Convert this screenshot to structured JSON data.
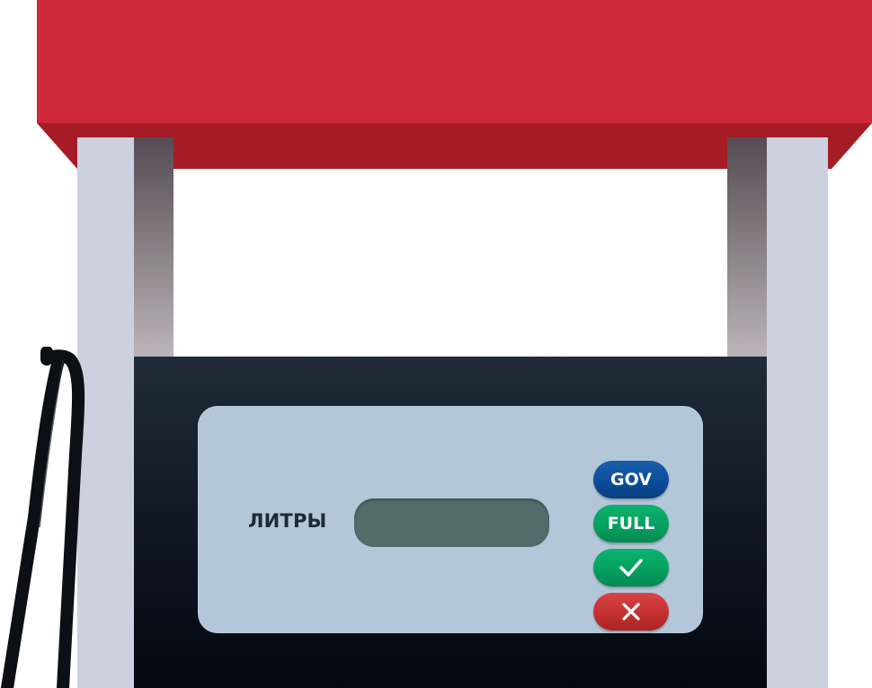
{
  "display": {
    "label": "ЛИТРЫ",
    "value": ""
  },
  "buttons": {
    "gov_label": "GOV",
    "full_label": "FULL",
    "confirm_icon": "checkmark-icon",
    "cancel_icon": "close-icon"
  },
  "colors": {
    "canopy": "#cf2838",
    "canopy_shade": "#a51c27",
    "pillar": "#ccd1e0",
    "body": "#0f1620",
    "screen": "#b3c7d8",
    "lcd": "#536c6b",
    "gov": "#0b4b96",
    "full": "#059e5e",
    "confirm": "#059e5e",
    "cancel": "#c22e2e"
  }
}
